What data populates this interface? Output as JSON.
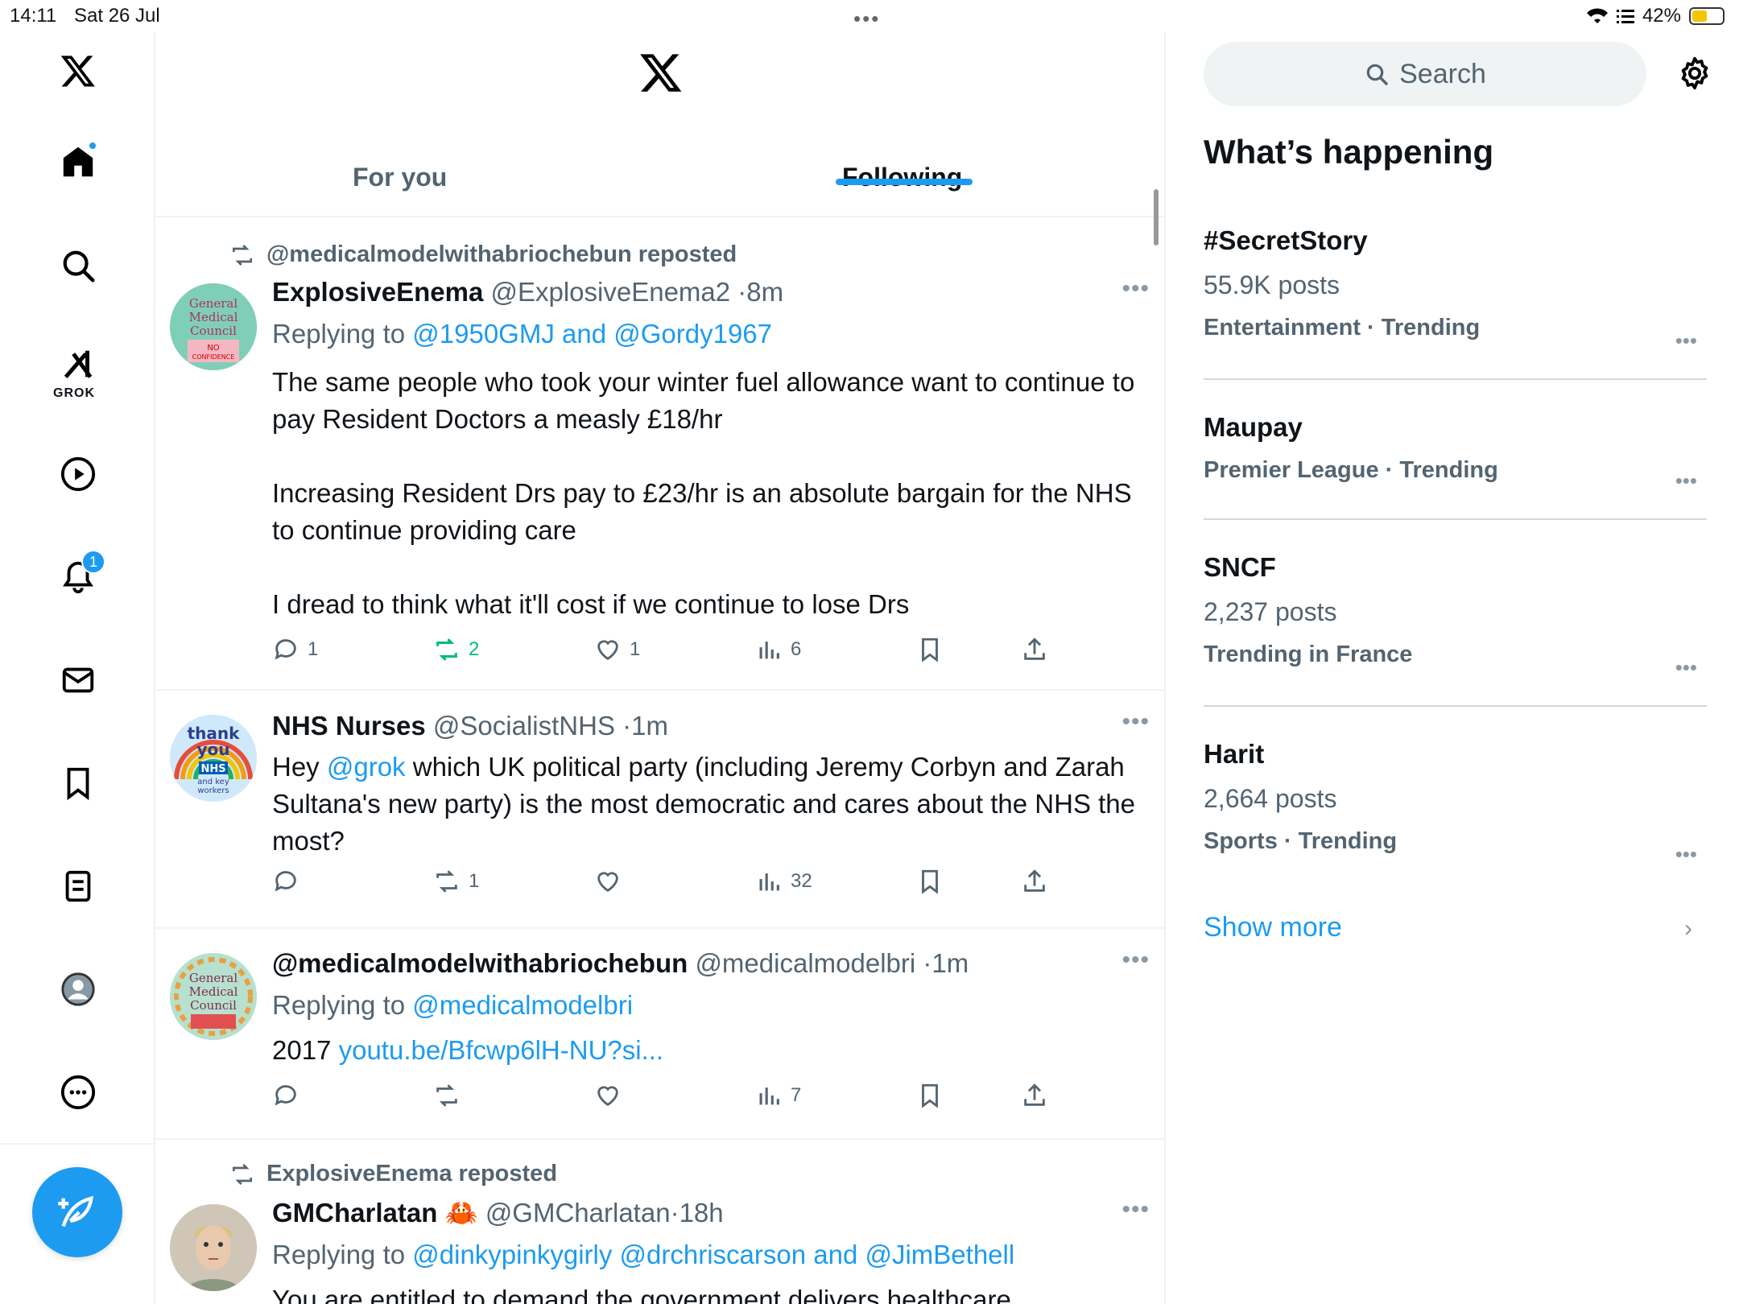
{
  "status": {
    "time": "14:11",
    "date": "Sat 26 Jul",
    "battery": "42%"
  },
  "nav": {
    "grok_label": "GROK",
    "notifications_count": "1"
  },
  "tabs": {
    "for_you": "For you",
    "following": "Following"
  },
  "posts": [
    {
      "repost_by": "@medicalmodelwithabriochebun reposted",
      "name": "ExplosiveEnema",
      "handle": "@ExplosiveEnema2",
      "time": "8m",
      "replying_prefix": "Replying to ",
      "replying_to": "@1950GMJ and @Gordy1967",
      "paragraphs": [
        "The same people who took your winter fuel allowance want to continue to pay Resident Doctors a measly £18/hr",
        "Increasing Resident Drs pay to £23/hr is an absolute bargain for the NHS to continue providing care",
        "I dread to think what it'll cost if we continue to lose Drs"
      ],
      "replies": "1",
      "reposts": "2",
      "likes": "1",
      "views": "6",
      "avatar_text": [
        "General",
        "Medical",
        "Council",
        "NO",
        "CONFIDENCE"
      ]
    },
    {
      "name": "NHS Nurses",
      "handle": "@SocialistNHS",
      "time": "1m",
      "mention": "@grok",
      "text_before": "Hey ",
      "text_after": " which UK political party (including Jeremy Corbyn and Zarah Sultana's new party) is the most democratic and cares about the NHS the most?",
      "replies": "",
      "reposts": "1",
      "likes": "",
      "views": "32",
      "avatar_text": [
        "thank",
        "you",
        "NHS",
        "and key",
        "workers"
      ]
    },
    {
      "name": "@medicalmodelwithabriochebun",
      "handle": "@medicalmodelbri",
      "time": "1m",
      "replying_prefix": "Replying to ",
      "replying_to": "@medicalmodelbri",
      "text_before": "2017 ",
      "link": "youtu.be/Bfcwp6lH-NU?si...",
      "replies": "",
      "reposts": "",
      "likes": "",
      "views": "7",
      "avatar_text": [
        "General",
        "Medical",
        "Council"
      ]
    },
    {
      "repost_by": "ExplosiveEnema reposted",
      "name": "GMCharlatan",
      "emoji": "🦀",
      "handle": "@GMCharlatan",
      "time": "18h",
      "replying_prefix": "Replying to ",
      "replying_to": "@dinkypinkygirly @drchriscarson and @JimBethell",
      "text": "You are entitled to demand the government delivers healthcare"
    }
  ],
  "sidebar": {
    "search_placeholder": "Search",
    "heading": "What’s happening",
    "trends": [
      {
        "title": "#SecretStory",
        "count": "55.9K posts",
        "meta": "Entertainment · Trending"
      },
      {
        "title": "Maupay",
        "count": "",
        "meta": "Premier League · Trending"
      },
      {
        "title": "SNCF",
        "count": "2,237 posts",
        "meta": "Trending in France"
      },
      {
        "title": "Harit",
        "count": "2,664 posts",
        "meta": "Sports · Trending"
      }
    ],
    "show_more": "Show more"
  },
  "colors": {
    "accent": "#1d9bf0",
    "repost_green": "#00ba7c",
    "secondary_text": "#536471"
  }
}
